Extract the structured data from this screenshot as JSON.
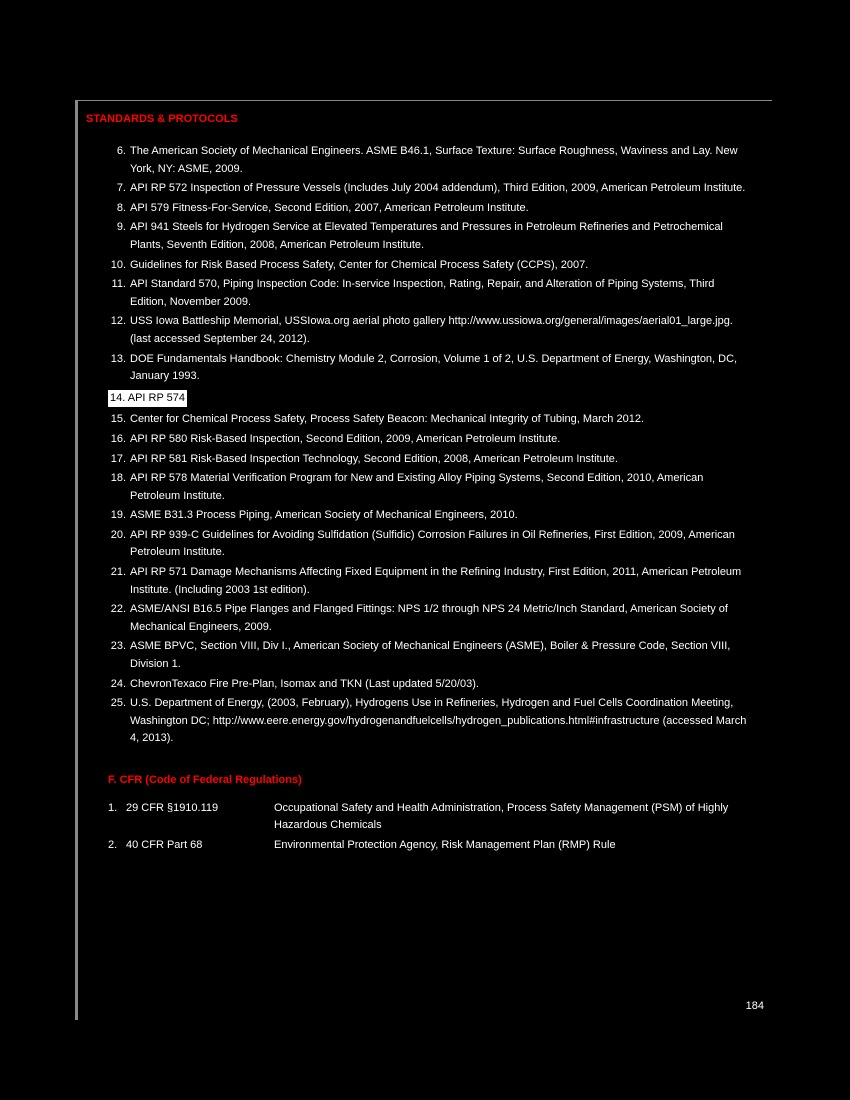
{
  "header": "STANDARDS & PROTOCOLS",
  "section1": [
    {
      "n": "6.",
      "t": "The American Society of Mechanical Engineers. ASME B46.1, Surface Texture: Surface Roughness, Waviness and Lay. New York, NY: ASME, 2009."
    },
    {
      "n": "7.",
      "t": "API RP 572 Inspection of Pressure Vessels (Includes July 2004 addendum), Third Edition, 2009, American Petroleum Institute."
    },
    {
      "n": "8.",
      "t": "API 579 Fitness-For-Service, Second Edition, 2007, American Petroleum Institute."
    },
    {
      "n": "9.",
      "t": "API 941 Steels for Hydrogen Service at Elevated Temperatures and Pressures in Petroleum Refineries and Petrochemical Plants, Seventh Edition, 2008, American Petroleum Institute."
    },
    {
      "n": "10.",
      "t": "Guidelines for Risk Based Process Safety, Center for Chemical Process Safety (CCPS), 2007."
    },
    {
      "n": "11.",
      "t": "API Standard 570, Piping Inspection Code: In-service Inspection, Rating, Repair, and Alteration of Piping Systems, Third Edition, November 2009."
    },
    {
      "n": "12.",
      "t": "USS Iowa Battleship Memorial, USSIowa.org aerial photo gallery http://www.ussiowa.org/general/images/aerial01_large.jpg. (last accessed September 24, 2012)."
    },
    {
      "n": "13.",
      "t": "DOE Fundamentals Handbook: Chemistry Module 2, Corrosion, Volume 1 of 2, U.S. Department of Energy, Washington, DC, January 1993."
    }
  ],
  "highlight": "14. API RP 574",
  "section2": [
    {
      "n": "15.",
      "t": "Center for Chemical Process Safety, Process Safety Beacon: Mechanical Integrity of Tubing, March 2012."
    },
    {
      "n": "16.",
      "t": "API RP 580 Risk-Based Inspection, Second Edition, 2009, American Petroleum Institute."
    },
    {
      "n": "17.",
      "t": "API RP 581 Risk-Based Inspection Technology, Second Edition, 2008, American Petroleum Institute."
    },
    {
      "n": "18.",
      "t": "API RP 578 Material Verification Program for New and Existing Alloy Piping Systems, Second Edition, 2010, American Petroleum Institute."
    },
    {
      "n": "19.",
      "t": "ASME B31.3 Process Piping, American Society of Mechanical Engineers, 2010."
    },
    {
      "n": "20.",
      "t": "API RP 939-C Guidelines for Avoiding Sulfidation (Sulfidic) Corrosion Failures in Oil Refineries, First Edition, 2009, American Petroleum Institute."
    },
    {
      "n": "21.",
      "t": "API RP 571 Damage Mechanisms Affecting Fixed Equipment in the Refining Industry, First Edition, 2011, American Petroleum Institute. (Including 2003 1st edition)."
    },
    {
      "n": "22.",
      "t": "ASME/ANSI B16.5 Pipe Flanges and Flanged Fittings: NPS 1/2 through NPS 24 Metric/Inch Standard, American Society of Mechanical Engineers, 2009."
    },
    {
      "n": "23.",
      "t": "ASME BPVC, Section VIII, Div I., American Society of Mechanical Engineers (ASME), Boiler & Pressure Code, Section VIII, Division 1."
    },
    {
      "n": "24.",
      "t": "ChevronTexaco Fire Pre-Plan, Isomax and TKN (Last updated 5/20/03)."
    },
    {
      "n": "25.",
      "t": "U.S. Department of Energy, (2003, February), Hydrogens Use in Refineries, Hydrogen and Fuel Cells Coordination Meeting, Washington DC; http://www.eere.energy.gov/hydrogenandfuelcells/hydrogen_publications.html#infrastructure (accessed March 4, 2013)."
    }
  ],
  "section_head": "F. CFR (Code of Federal Regulations)",
  "cfr": [
    {
      "n": "1.",
      "c": "29 CFR §1910.119",
      "d": "Occupational Safety and Health Administration, Process Safety Management (PSM) of Highly Hazardous Chemicals"
    },
    {
      "n": "2.",
      "c": "40 CFR Part 68",
      "d": "Environmental Protection Agency, Risk Management Plan (RMP) Rule"
    }
  ],
  "footer": "184"
}
